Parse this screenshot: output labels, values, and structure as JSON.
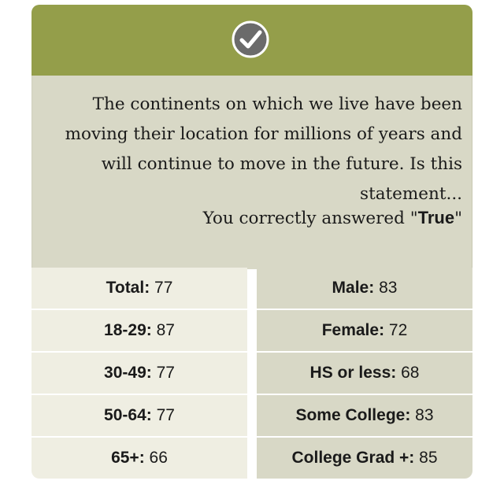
{
  "question": {
    "text": "The continents on which we live have been moving their location for millions of years and will continue to move in the future. Is this statement...",
    "answer_prefix": "You correctly answered \"",
    "answer_value": "True",
    "answer_suffix": "\""
  },
  "status_icon": "checkmark-circle-icon",
  "colors": {
    "header": "#949e4a",
    "question_bg": "#d8d8c6",
    "left_cells": "#efeee2",
    "right_cells": "#d8d8c6"
  },
  "stats_left": [
    {
      "label": "Total:",
      "value": "77"
    },
    {
      "label": "18-29:",
      "value": "87"
    },
    {
      "label": "30-49:",
      "value": "77"
    },
    {
      "label": "50-64:",
      "value": "77"
    },
    {
      "label": "65+:",
      "value": "66"
    }
  ],
  "stats_right": [
    {
      "label": "Male:",
      "value": "83"
    },
    {
      "label": "Female:",
      "value": "72"
    },
    {
      "label": "HS or less:",
      "value": "68"
    },
    {
      "label": "Some College:",
      "value": "83"
    },
    {
      "label": "College Grad +:",
      "value": "85"
    }
  ]
}
